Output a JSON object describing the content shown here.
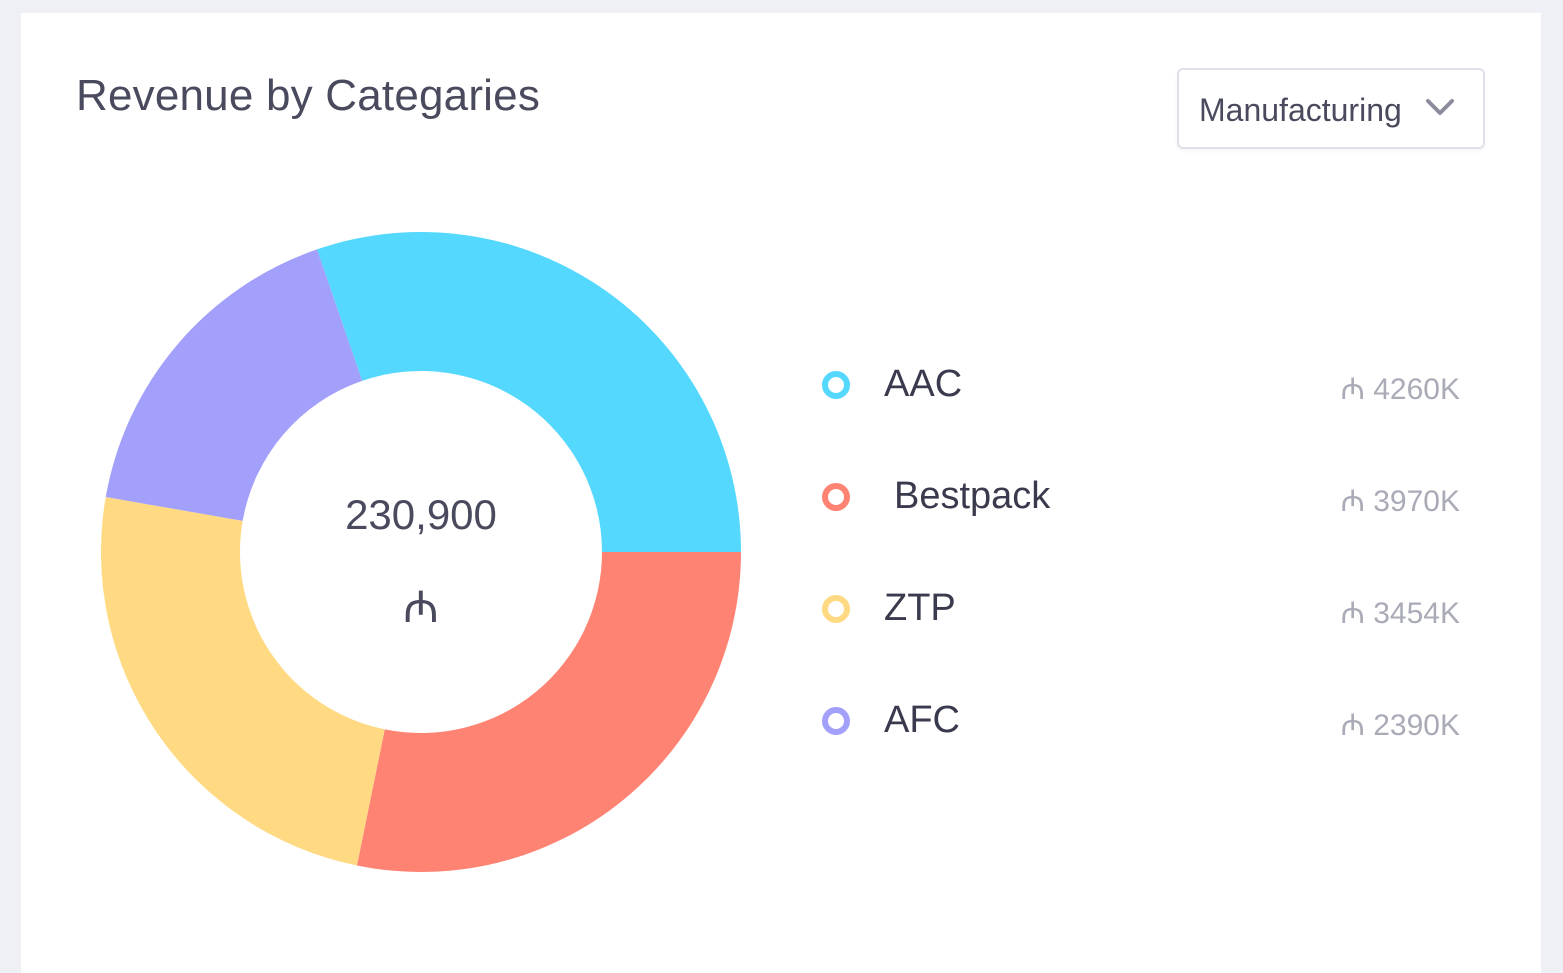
{
  "card": {
    "title": "Revenue by Categaries"
  },
  "filter": {
    "selected": "Manufacturing",
    "chevron_icon": "chevron-down-icon"
  },
  "center": {
    "total": "230,900",
    "currency": "₼"
  },
  "legend": {
    "items": [
      {
        "name": "AAC",
        "value": "₼ 4260K",
        "color": "#55d8fe"
      },
      {
        "name": "Bestpack",
        "value": "₼ 3970K",
        "color": "#ff8373"
      },
      {
        "name": "ZTP",
        "value": "₼ 3454K",
        "color": "#ffda83"
      },
      {
        "name": "AFC",
        "value": "₼ 2390K",
        "color": "#a3a0fb"
      }
    ]
  },
  "chart_data": {
    "type": "pie",
    "title": "Revenue by Categaries",
    "categories": [
      "AAC",
      "Bestpack",
      "ZTP",
      "AFC"
    ],
    "values": [
      4260,
      3970,
      3454,
      2390
    ],
    "unit": "K",
    "colors": [
      "#55d8fe",
      "#ff8373",
      "#ffda83",
      "#a3a0fb"
    ],
    "donut": true,
    "legend_position": "right"
  }
}
